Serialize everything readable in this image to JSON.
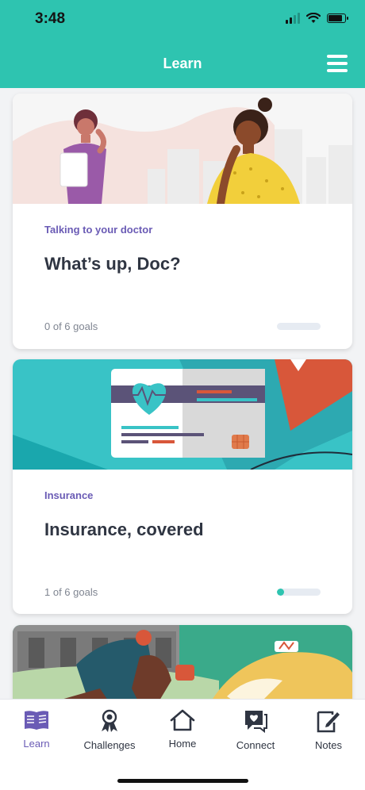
{
  "status": {
    "time": "3:48"
  },
  "header": {
    "title": "Learn"
  },
  "cards": [
    {
      "category": "Talking to your doctor",
      "title": "What’s up, Doc?",
      "goals": "0 of 6 goals",
      "progress": 0.0
    },
    {
      "category": "Insurance",
      "title": "Insurance, covered",
      "goals": "1 of 6 goals",
      "progress": 0.17
    }
  ],
  "tabs": [
    {
      "label": "Learn",
      "icon": "book-icon"
    },
    {
      "label": "Challenges",
      "icon": "ribbon-icon"
    },
    {
      "label": "Home",
      "icon": "home-icon"
    },
    {
      "label": "Connect",
      "icon": "chat-heart-icon"
    },
    {
      "label": "Notes",
      "icon": "notes-icon"
    }
  ],
  "colors": {
    "accent": "#2ec4b0",
    "active_tab": "#6a5bb5",
    "text": "#2f3542"
  }
}
